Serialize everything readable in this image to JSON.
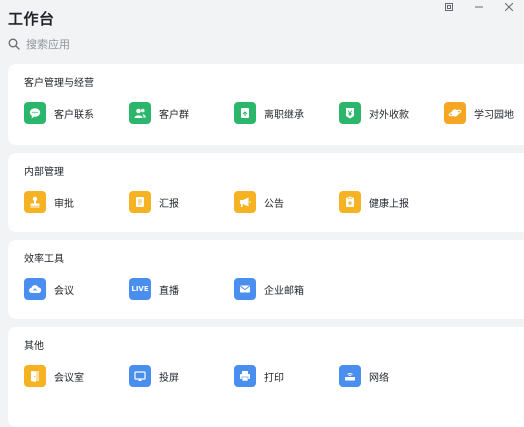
{
  "app": {
    "title": "工作台"
  },
  "window_controls": [
    "restore-icon",
    "minimize-icon",
    "close-icon"
  ],
  "search": {
    "placeholder": "搜索应用",
    "value": ""
  },
  "sections": [
    {
      "title": "客户管理与经营",
      "items": [
        {
          "label": "客户联系",
          "icon": "chat-bubble-icon",
          "color": "#2bb66b"
        },
        {
          "label": "客户群",
          "icon": "group-icon",
          "color": "#2bb66b"
        },
        {
          "label": "离职继承",
          "icon": "handover-doc-icon",
          "color": "#2bb66b"
        },
        {
          "label": "对外收款",
          "icon": "yen-icon",
          "color": "#2bb66b"
        },
        {
          "label": "学习园地",
          "icon": "planet-icon",
          "color": "#f5a623"
        }
      ]
    },
    {
      "title": "内部管理",
      "items": [
        {
          "label": "审批",
          "icon": "stamp-icon",
          "color": "#f5b324"
        },
        {
          "label": "汇报",
          "icon": "report-icon",
          "color": "#f5b324"
        },
        {
          "label": "公告",
          "icon": "megaphone-icon",
          "color": "#f5b324"
        },
        {
          "label": "健康上报",
          "icon": "health-report-icon",
          "color": "#f5b324"
        }
      ]
    },
    {
      "title": "效率工具",
      "items": [
        {
          "label": "会议",
          "icon": "cloud-meeting-icon",
          "color": "#4a8ef0"
        },
        {
          "label": "直播",
          "icon": "live-icon",
          "color": "#4a8ef0",
          "text": "LIVE"
        },
        {
          "label": "企业邮箱",
          "icon": "mail-icon",
          "color": "#4a8ef0"
        }
      ]
    },
    {
      "title": "其他",
      "items": [
        {
          "label": "会议室",
          "icon": "door-icon",
          "color": "#f5b324"
        },
        {
          "label": "投屏",
          "icon": "screen-cast-icon",
          "color": "#4a8ef0"
        },
        {
          "label": "打印",
          "icon": "printer-icon",
          "color": "#4a8ef0"
        },
        {
          "label": "网络",
          "icon": "wifi-router-icon",
          "color": "#4a8ef0"
        }
      ]
    }
  ]
}
